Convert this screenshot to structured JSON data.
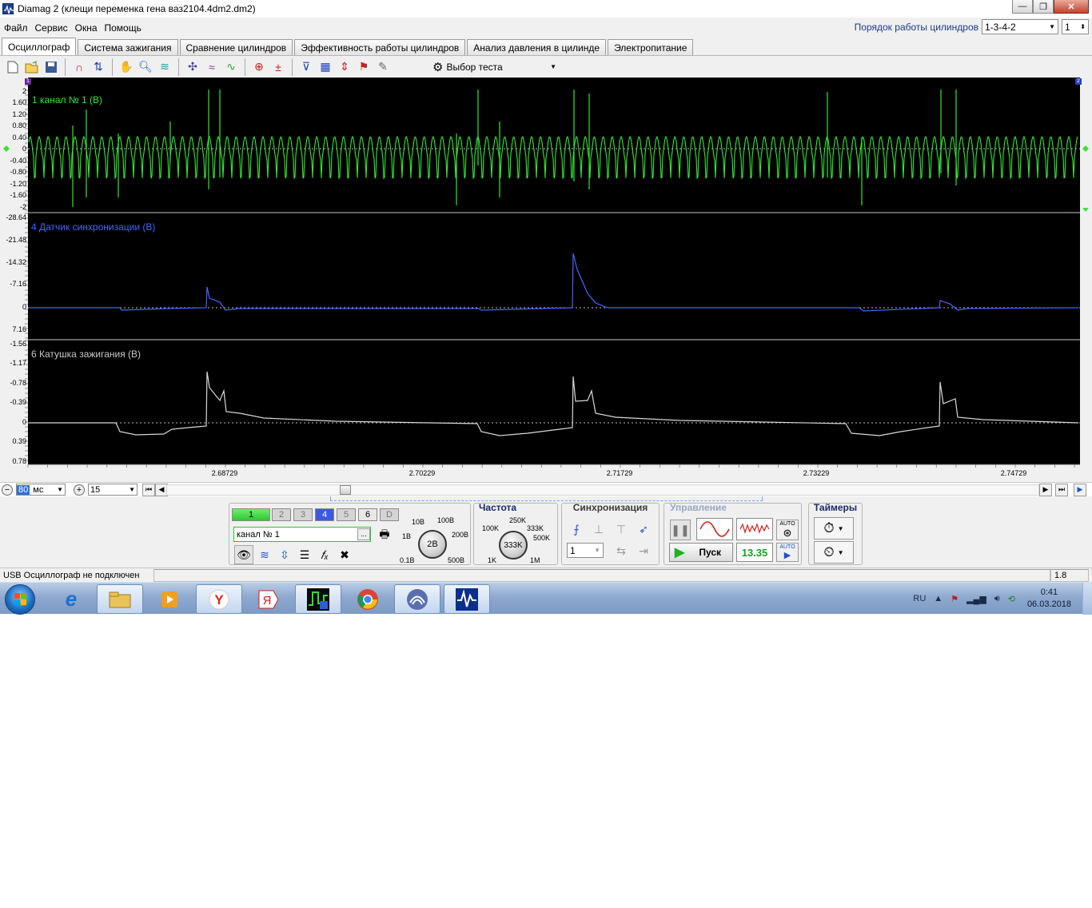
{
  "window": {
    "title": "Diamag 2 (клещи переменка гена ваз2104.4dm2.dm2)",
    "minimize": "—",
    "maximize": "❐",
    "close": "✕"
  },
  "menu": [
    "Файл",
    "Сервис",
    "Окна",
    "Помощь"
  ],
  "cylinder_order": {
    "label": "Порядок работы цилиндров",
    "value": "1-3-4-2",
    "cylinder": "1"
  },
  "tabs": [
    "Осциллограф",
    "Система зажигания",
    "Сравнение цилиндров",
    "Эффективность работы цилиндров",
    "Анализ давления в цилинде",
    "Электропитание"
  ],
  "active_tab": 0,
  "toolbar": {
    "test_select": "Выбор теста"
  },
  "markers": {
    "left": "1",
    "right": "2"
  },
  "channels": [
    {
      "title": "1 канал № 1 (В)",
      "color": "#33e633",
      "ticks": [
        "2",
        "1.60",
        "1.20",
        "0.80",
        "0.40",
        "0",
        "-0.40",
        "-0.80",
        "-1.20",
        "-1.60",
        "-2"
      ]
    },
    {
      "title": "4 Датчик синхронизации (В)",
      "color": "#4466ff",
      "ticks": [
        "-28.64",
        "-21.48",
        "-14.32",
        "-7.16",
        "0",
        "7.16"
      ]
    },
    {
      "title": "6 Катушка зажигания (В)",
      "color": "#d8d8d8",
      "ticks": [
        "-1.56",
        "-1.17",
        "-0.78",
        "-0.39",
        "0",
        "0.39",
        "0.78"
      ]
    }
  ],
  "x_ticks": [
    "2.68729",
    "2.70229",
    "2.71729",
    "2.73229",
    "2.74729"
  ],
  "timebar": {
    "zoom_value": "80",
    "zoom_unit": "мс",
    "zoom2_value": "15"
  },
  "control": {
    "channel_buttons": [
      "1",
      "2",
      "3",
      "4",
      "5",
      "6",
      "D"
    ],
    "channel_name": "канал № 1",
    "more": "...",
    "voltage": {
      "value": "2В",
      "labels": [
        "10В",
        "100В",
        "1В",
        "200В",
        "0.1В",
        "500В"
      ]
    },
    "freq": {
      "title": "Частота",
      "value": "333K",
      "labels": [
        "250K",
        "100K",
        "333K",
        "500K",
        "1K",
        "1M"
      ]
    },
    "sync": {
      "title": "Синхронизация",
      "value": "1"
    },
    "mgmt": {
      "title": "Управление",
      "start": "Пуск",
      "value": "13.35",
      "auto": "AUTO"
    },
    "timers": {
      "title": "Таймеры"
    }
  },
  "status": {
    "text": "USB Осциллограф не подключен",
    "right": "1.8"
  },
  "taskbar": {
    "lang": "RU",
    "time": "0:41",
    "date": "06.03.2018"
  }
}
